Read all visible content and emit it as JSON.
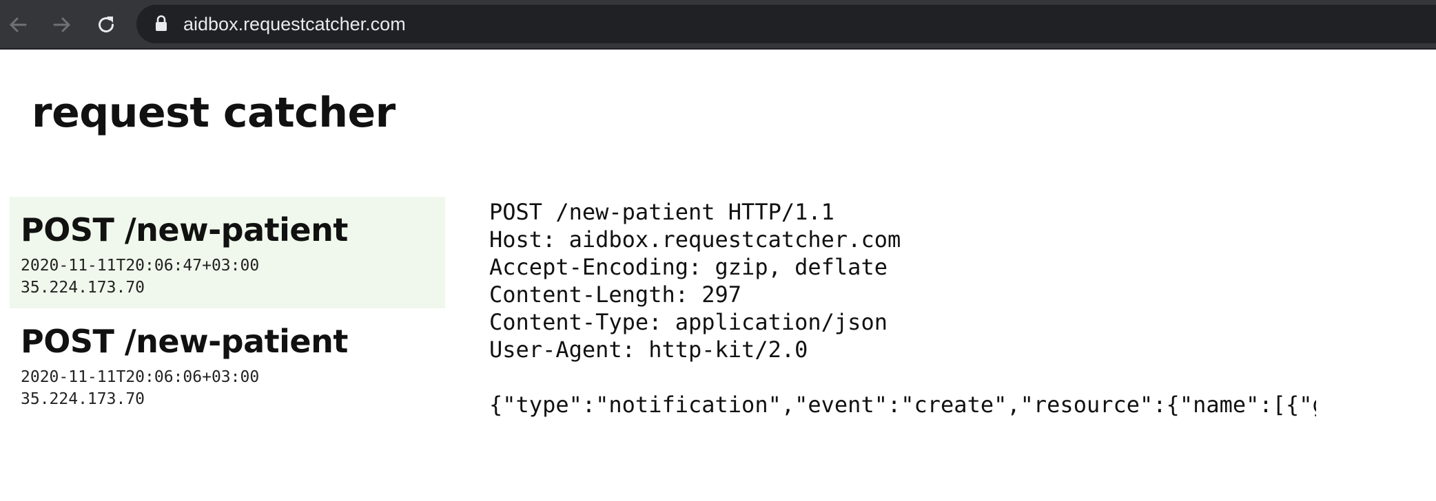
{
  "browser": {
    "url": "aidbox.requestcatcher.com",
    "icons": {
      "back": "arrow-left-icon",
      "forward": "arrow-right-icon",
      "reload": "reload-icon",
      "lock": "lock-icon"
    }
  },
  "page": {
    "title": "request catcher"
  },
  "requests": [
    {
      "title": "POST /new-patient",
      "timestamp": "2020-11-11T20:06:47+03:00",
      "ip": "35.224.173.70",
      "selected": true
    },
    {
      "title": "POST /new-patient",
      "timestamp": "2020-11-11T20:06:06+03:00",
      "ip": "35.224.173.70",
      "selected": false
    }
  ],
  "detail": {
    "request_line": "POST /new-patient HTTP/1.1",
    "headers": [
      "Host: aidbox.requestcatcher.com",
      "Accept-Encoding: gzip, deflate",
      "Content-Length: 297",
      "Content-Type: application/json",
      "User-Agent: http-kit/2.0"
    ],
    "body": "{\"type\":\"notification\",\"event\":\"create\",\"resource\":{\"name\":[{\"g"
  },
  "colors": {
    "toolbar_bg": "#35363a",
    "omnibox_bg": "#202124",
    "selected_bg": "#f0f7ec",
    "text": "#111111"
  }
}
